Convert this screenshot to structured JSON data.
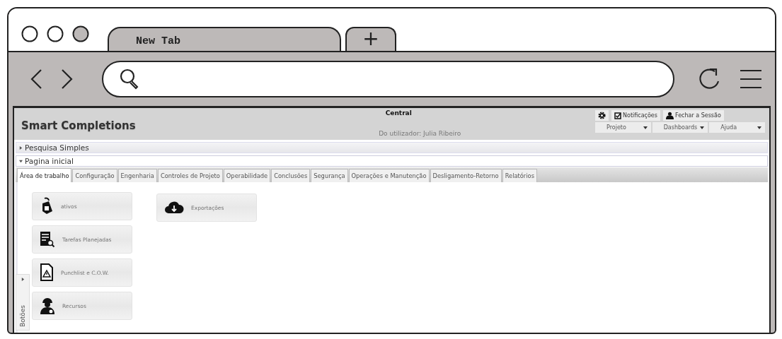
{
  "browser": {
    "tab_title": "New Tab",
    "new_tab": "+"
  },
  "header": {
    "app_title": "Smart Completions",
    "center_title": "Central",
    "user_line": "Do utilizador: Julia Ribeiro",
    "actions": [
      {
        "label": "Notificações"
      },
      {
        "label": "Fechar a Sessão"
      }
    ],
    "menus": [
      {
        "label": "Projeto"
      },
      {
        "label": "Dashboards"
      },
      {
        "label": "Ajuda"
      }
    ]
  },
  "sections": [
    {
      "label": "Pesquisa Simples",
      "expanded": false
    },
    {
      "label": "Pagina inicial",
      "expanded": true
    }
  ],
  "tabs": [
    {
      "label": "Área de trabalho",
      "selected": true
    },
    {
      "label": "Configuração",
      "selected": false
    },
    {
      "label": "Engenharia",
      "selected": false
    },
    {
      "label": "Controles de Projeto",
      "selected": false
    },
    {
      "label": "Operabilidade",
      "selected": false
    },
    {
      "label": "Conclusões",
      "selected": false
    },
    {
      "label": "Segurança",
      "selected": false
    },
    {
      "label": "Operações e Manutenção",
      "selected": false
    },
    {
      "label": "Desligamento-Retorno",
      "selected": false
    },
    {
      "label": "Relatórios",
      "selected": false
    }
  ],
  "tile_columns": [
    [
      {
        "label": "ativos"
      },
      {
        "label": "Tarefas Planejadas"
      },
      {
        "label": "Punchlist e C.O.W."
      },
      {
        "label": "Recursos"
      }
    ],
    [
      {
        "label": "Exportações"
      }
    ]
  ],
  "side_panel": {
    "label": "Botões",
    "expanded": false
  }
}
